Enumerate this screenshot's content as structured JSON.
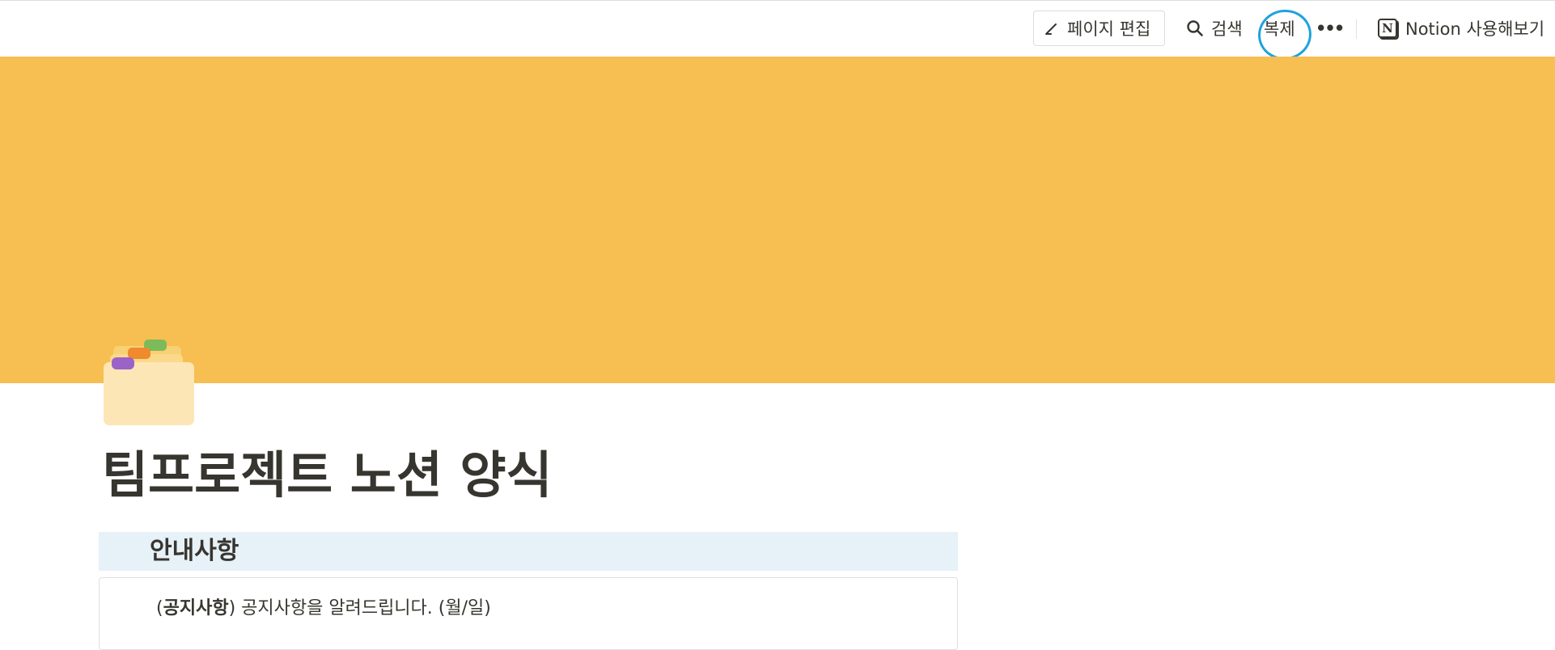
{
  "topbar": {
    "edit_label": "페이지 편집",
    "search_label": "검색",
    "duplicate_label": "복제",
    "more_label": "•••",
    "notion_logo": "N",
    "notion_label": "Notion 사용해보기"
  },
  "colors": {
    "cover": "#f7be51",
    "callout_head_bg": "#e7f1f8",
    "annotation_circle": "#1fa2dc",
    "text": "#37352f"
  },
  "icons": {
    "edit": "pencil-icon",
    "search": "search-icon",
    "notion": "notion-logo-icon",
    "page": "card-index-dividers-icon"
  },
  "page": {
    "title": "팀프로젝트 노션 양식"
  },
  "callout": {
    "heading": "안내사항",
    "open_paren": "(",
    "bold_text": "공지사항",
    "close_paren": ")",
    "text": " 공지사항을 알려드립니다. (월/일)"
  }
}
